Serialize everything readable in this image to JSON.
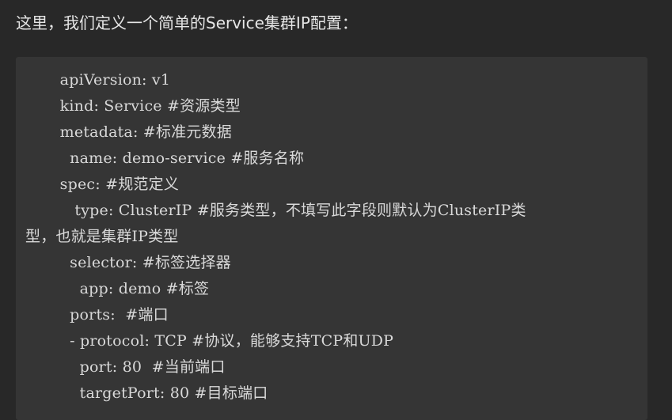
{
  "intro_text": "这里，我们定义一个简单的Service集群IP配置：",
  "code_lines": [
    "       apiVersion: v1",
    "       kind: Service #资源类型",
    "       metadata: #标准元数据",
    "         name: demo-service #服务名称",
    "       spec: #规范定义",
    "          type: ClusterIP #服务类型，不填写此字段则默认为ClusterIP类",
    "型，也就是集群IP类型",
    "         selector: #标签选择器",
    "           app: demo #标签",
    "         ports:  #端口",
    "         - protocol: TCP #协议，能够支持TCP和UDP",
    "           port: 80  #当前端口",
    "           targetPort: 80 #目标端口"
  ]
}
